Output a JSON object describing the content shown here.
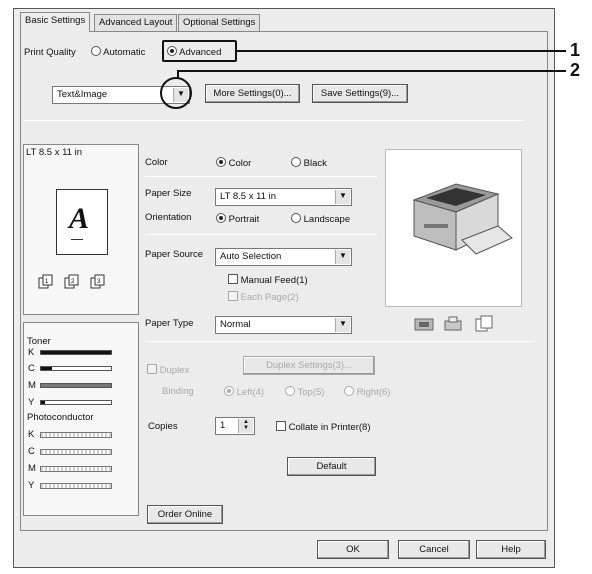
{
  "tabs": [
    {
      "label": "Basic Settings",
      "active": true
    },
    {
      "label": "Advanced Layout",
      "active": false
    },
    {
      "label": "Optional Settings",
      "active": false
    }
  ],
  "print_quality": {
    "label": "Print Quality",
    "automatic_label": "Automatic",
    "advanced_label": "Advanced",
    "selected": "Advanced",
    "mode_value": "Text&Image",
    "more_settings": "More Settings(0)...",
    "save_settings": "Save Settings(9)..."
  },
  "paper_preview": {
    "size_label": "LT 8.5 x 11 in",
    "glyph": "A"
  },
  "consumables": {
    "toner_label": "Toner",
    "toner": [
      {
        "letter": "K",
        "level": 1.0
      },
      {
        "letter": "C",
        "level": 0.15
      },
      {
        "letter": "M",
        "level": 1.0
      },
      {
        "letter": "Y",
        "level": 0.05
      }
    ],
    "photo_label": "Photoconductor",
    "photo": [
      {
        "letter": "K",
        "level": 0.5
      },
      {
        "letter": "C",
        "level": 0.5
      },
      {
        "letter": "M",
        "level": 0.5
      },
      {
        "letter": "Y",
        "level": 0.5
      }
    ]
  },
  "color": {
    "label": "Color",
    "color_label": "Color",
    "black_label": "Black",
    "selected": "Color"
  },
  "paper_size": {
    "label": "Paper Size",
    "value": "LT 8.5 x 11 in"
  },
  "orientation": {
    "label": "Orientation",
    "portrait_label": "Portrait",
    "landscape_label": "Landscape",
    "selected": "Portrait"
  },
  "paper_source": {
    "label": "Paper Source",
    "value": "Auto Selection",
    "manual_feed_label": "Manual Feed(1)",
    "each_page_label": "Each Page(2)"
  },
  "paper_type": {
    "label": "Paper Type",
    "value": "Normal"
  },
  "duplex": {
    "label": "Duplex",
    "settings_label": "Duplex Settings(3)...",
    "binding_label": "Binding",
    "left_label": "Left(4)",
    "top_label": "Top(5)",
    "right_label": "Right(6)"
  },
  "copies": {
    "label": "Copies",
    "value": "1",
    "collate_label": "Collate in Printer(8)"
  },
  "default_button": "Default",
  "order_online_button": "Order Online",
  "footer": {
    "ok": "OK",
    "cancel": "Cancel",
    "help": "Help"
  },
  "callouts": {
    "one": "1",
    "two": "2"
  },
  "icons": {
    "printer": "printer-image",
    "status_icons": [
      "printer-status-icon",
      "printer-settings-icon",
      "document-icon"
    ],
    "page_icons": [
      "page-stack-icon-1",
      "page-stack-icon-2",
      "page-stack-icon-3"
    ]
  }
}
